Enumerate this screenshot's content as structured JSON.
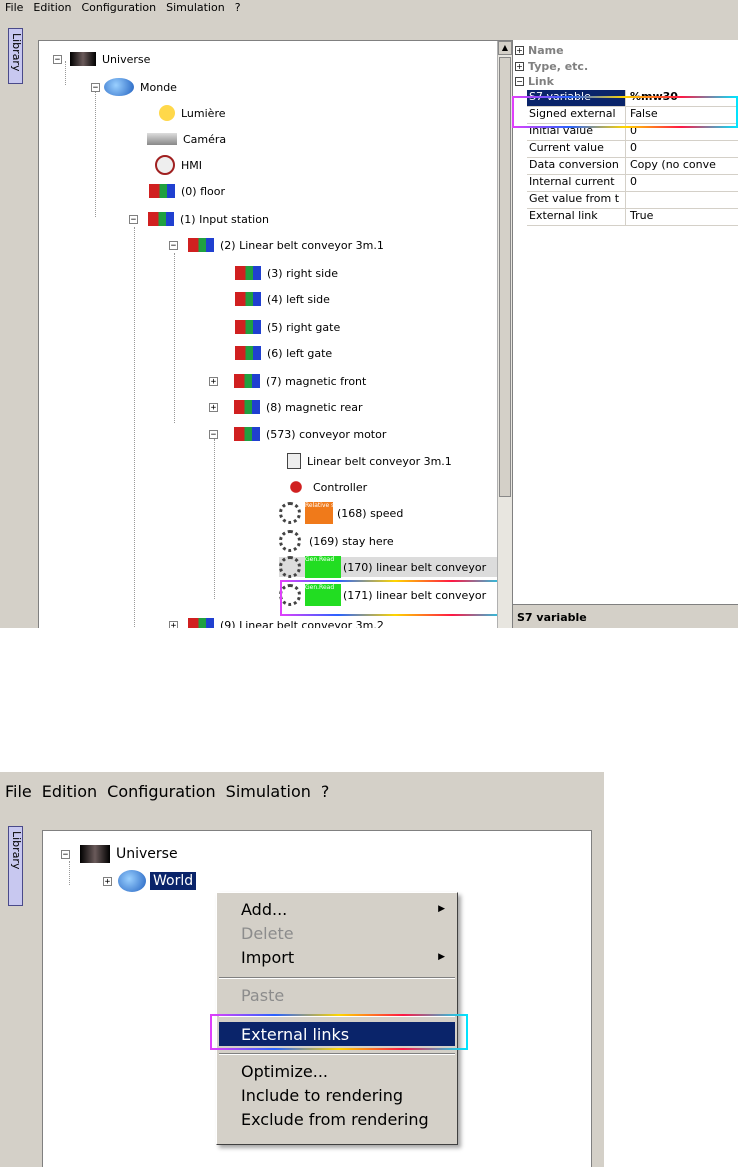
{
  "top": {
    "menu": [
      "File",
      "Edition",
      "Configuration",
      "Simulation",
      "?"
    ],
    "library_tab": "Library",
    "tree": {
      "universe": "Universe",
      "monde": "Monde",
      "lumiere": "Lumière",
      "camera": "Caméra",
      "hmi": "HMI",
      "floor": "(0) floor",
      "input_station": "(1) Input station",
      "conveyor1": "(2) Linear belt conveyor 3m.1",
      "right_side": "(3) right side",
      "left_side": "(4) left side",
      "right_gate": "(5) right gate",
      "left_gate": "(6) left gate",
      "magnetic_front": "(7) magnetic front",
      "magnetic_rear": "(8) magnetic rear",
      "conveyor_motor": "(573) conveyor motor",
      "linear_belt_item": "Linear belt conveyor 3m.1",
      "controller": "Controller",
      "speed": "(168) speed",
      "speed_tag": "Relative speed",
      "stay_here": "(169) stay here",
      "linear170": "(170) linear belt conveyor",
      "tag170": "Gen.Read",
      "linear171": "(171) linear belt conveyor",
      "tag171": "Gen.Read",
      "conveyor2": "(9) Linear belt conveyor 3m.2"
    },
    "props": {
      "categories": [
        "Name",
        "Type, etc.",
        "Link"
      ],
      "rows": [
        {
          "key": "S7 variable",
          "value": "%mw30"
        },
        {
          "key": "Signed external",
          "value": "False"
        },
        {
          "key": "Initial value",
          "value": "0"
        },
        {
          "key": "Current value",
          "value": "0"
        },
        {
          "key": "Data conversion",
          "value": "Copy (no conve"
        },
        {
          "key": "Internal current",
          "value": "0"
        },
        {
          "key": "Get value from t",
          "value": ""
        },
        {
          "key": "External link",
          "value": "True"
        }
      ],
      "footer": "S7 variable"
    }
  },
  "bottom": {
    "menu": [
      "File",
      "Edition",
      "Configuration",
      "Simulation",
      "?"
    ],
    "library_tab": "Library",
    "tree": {
      "universe": "Universe",
      "world": "World"
    },
    "context_menu": {
      "add": "Add...",
      "delete": "Delete",
      "import": "Import",
      "paste": "Paste",
      "external_links": "External links",
      "optimize": "Optimize...",
      "include": "Include to rendering",
      "exclude": "Exclude from rendering"
    }
  },
  "colors": {
    "selection": "#0a246a",
    "panel": "#d4d0c8",
    "speed_tag": "#f07a1a",
    "genread_tag": "#22dd22"
  }
}
